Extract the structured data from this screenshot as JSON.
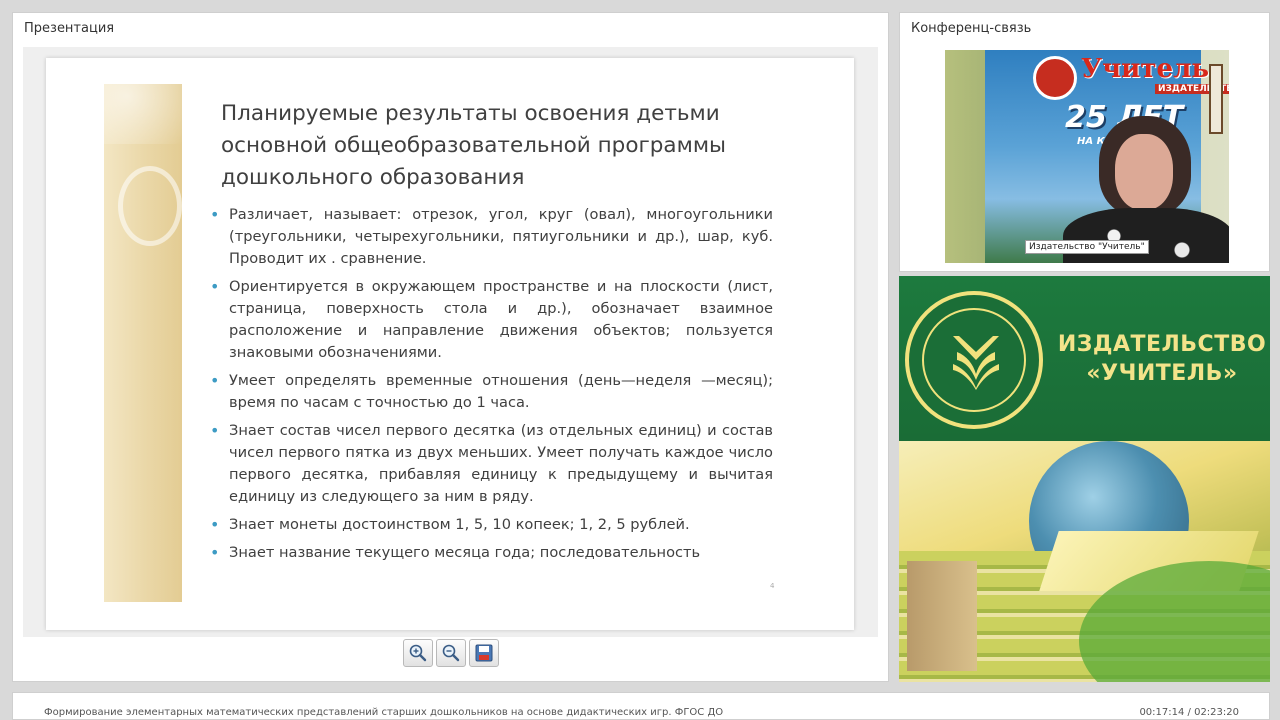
{
  "presentation": {
    "panel_title": "Презентация",
    "slide": {
      "title": "Планируемые результаты освоения детьми основной общеобразовательной программы дошкольного образования",
      "bullets": [
        "Различает, называет: отрезок, угол, круг (овал), многоугольники (треугольники, четырехугольники, пятиугольники и др.), шар, куб. Проводит их . сравнение.",
        "Ориентируется в окружающем пространстве и на плоскости (лист, страница, поверхность стола и др.), обозначает взаимное расположение и направление движения объектов; пользуется знаковыми обозначениями.",
        "Умеет определять временные отношения (день—неделя —месяц); время по часам с точностью до 1 часа.",
        "Знает состав чисел первого десятка (из отдельных единиц) и состав чисел первого пятка из двух меньших. Умеет получать каждое число первого десятка, прибавляя единицу к предыдущему и вычитая единицу из следующего за ним в ряду.",
        "Знает монеты достоинством 1, 5, 10 копеек; 1, 2, 5 рублей.",
        "Знает название текущего месяца года; последовательность"
      ],
      "page_number": "4"
    },
    "toolbar": {
      "zoom_in_icon": "zoom-in-icon",
      "zoom_out_icon": "zoom-out-icon",
      "save_icon": "save-icon"
    }
  },
  "conference": {
    "panel_title": "Конференц-связь",
    "video": {
      "speaker_label": "Издательство \"Учитель\"",
      "banner_brand": "Учитель",
      "banner_sub": "ИЗДАТЕЛЬСТВО",
      "banner_years": "25 ЛЕТ",
      "banner_tagline": "НА КНИЖНОМ Р"
    }
  },
  "ad": {
    "publisher_line1": "ИЗДАТЕЛЬСТВО",
    "publisher_line2": "«УЧИТЕЛЬ»",
    "colors": {
      "green": "#1d7a3e",
      "gold": "#f3e38a"
    }
  },
  "footer": {
    "lecture_title": "Формирование элементарных математических представлений старших дошкольников на основе дидактических игр. ФГОС ДО",
    "time": "00:17:14 / 02:23:20"
  },
  "colors": {
    "bullet": "#3d9bc4",
    "text": "#404040"
  }
}
